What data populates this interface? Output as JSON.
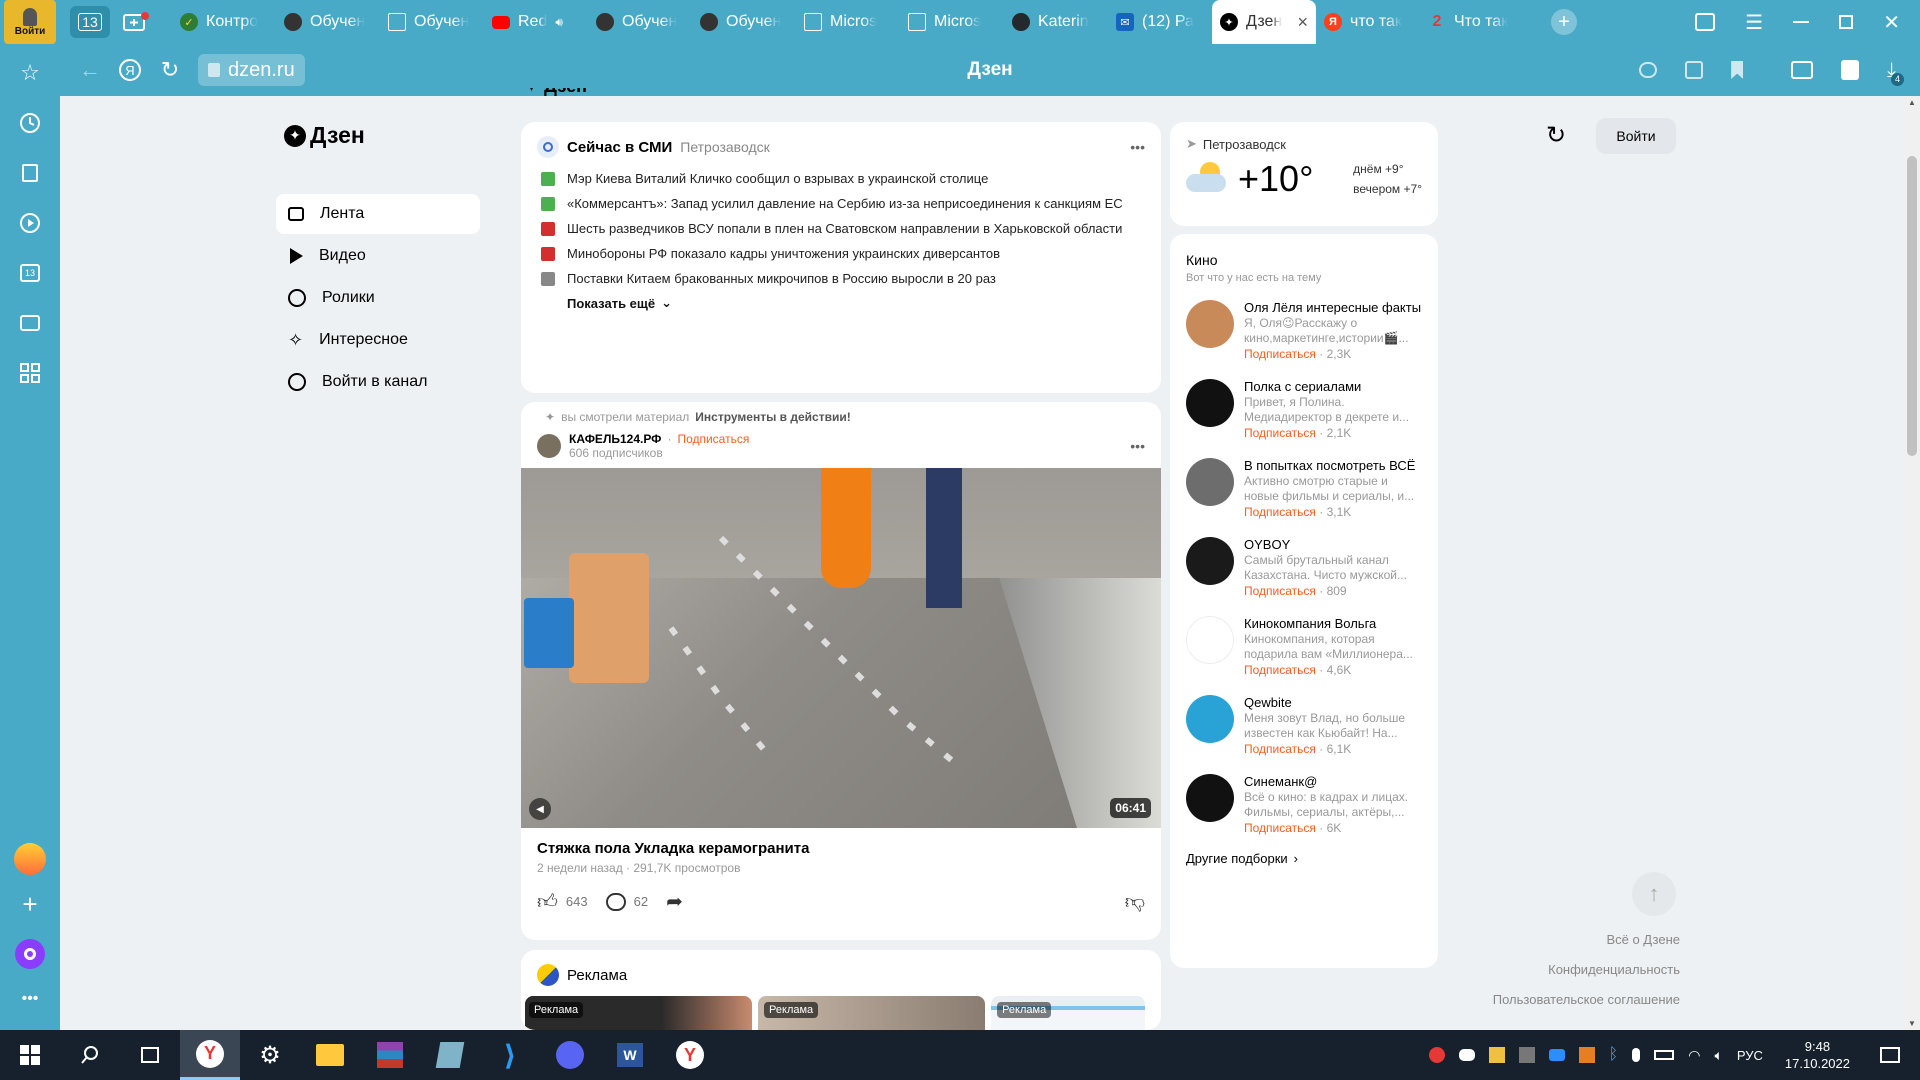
{
  "tabbar": {
    "profile_label": "Войти",
    "tab_count": "13",
    "tabs": [
      {
        "title": "Контро",
        "icon": "check-icon",
        "color": "#2e7d32"
      },
      {
        "title": "Обучен",
        "icon": "openai-icon",
        "color": "#333333"
      },
      {
        "title": "Обучен",
        "icon": "doc-icon",
        "color": "#ffffff"
      },
      {
        "title": "Red",
        "icon": "youtube-icon",
        "color": "#ff0000"
      },
      {
        "title": "Обучен",
        "icon": "openai-icon",
        "color": "#333333"
      },
      {
        "title": "Обучен",
        "icon": "openai-icon",
        "color": "#333333"
      },
      {
        "title": "Micros",
        "icon": "doc-icon",
        "color": "#ffffff"
      },
      {
        "title": "Micros",
        "icon": "doc-icon",
        "color": "#ffffff"
      },
      {
        "title": "Katerin",
        "icon": "github-icon",
        "color": "#24292e"
      },
      {
        "title": "(12) Ра",
        "icon": "mail-icon",
        "color": "#1565c0"
      },
      {
        "title": "Дзен",
        "icon": "dzen-icon",
        "color": "#000000"
      },
      {
        "title": "что так",
        "icon": "yandex-icon",
        "color": "#fc3f1d"
      },
      {
        "title": "Что так",
        "icon": "two-icon",
        "color": "#e53935"
      }
    ]
  },
  "addressbar": {
    "url": "dzen.ru",
    "page_title": "Дзен",
    "downloads_badge": "4"
  },
  "sidebar": {
    "logo": "Дзен",
    "items": [
      {
        "label": "Лента"
      },
      {
        "label": "Видео"
      },
      {
        "label": "Ролики"
      },
      {
        "label": "Интересное"
      },
      {
        "label": "Войти в канал"
      }
    ]
  },
  "header": {
    "login_button": "Войти"
  },
  "news": {
    "title": "Сейчас в СМИ",
    "city": "Петрозаводск",
    "items": [
      {
        "text": "Мэр Киева Виталий Кличко сообщил о взрывах в украинской столице",
        "src": "#4caf50"
      },
      {
        "text": "«Коммерсантъ»: Запад усилил давление на Сербию из-за неприсоединения к санкциям ЕС",
        "src": "#4caf50"
      },
      {
        "text": "Шесть разведчиков ВСУ попали в плен на Сватовском направлении в Харьковской области",
        "src": "#d32f2f"
      },
      {
        "text": "Минобороны РФ показало кадры уничтожения украинских диверсантов",
        "src": "#d32f2f"
      },
      {
        "text": "Поставки Китаем бракованных микрочипов в Россию выросли в 20 раз",
        "src": "#888888"
      }
    ],
    "more": "Показать ещё"
  },
  "post": {
    "hint": "вы смотрели материал",
    "hint_bold": "Инструменты в действии!",
    "channel": "КАФЕЛЬ124.РФ",
    "subscribe": "Подписаться",
    "subscribers": "606 подписчиков",
    "duration": "06:41",
    "title": "Стяжка пола Укладка керамогранита",
    "meta": "2 недели назад · 291,7K просмотров",
    "likes": "643",
    "comments": "62"
  },
  "ads": {
    "title": "Реклама",
    "label": "Реклама"
  },
  "weather": {
    "city": "Петрозаводск",
    "temp": "+10°",
    "day": "днём +9°",
    "evening": "вечером +7°"
  },
  "kino": {
    "title": "Кино",
    "subtitle": "Вот что у нас есть на тему",
    "channels": [
      {
        "name": "Оля Лёля интересные факты",
        "desc": "Я, Оля😉Расскажу о кино,маркетинге,истории🎬...",
        "subs": "2,3K",
        "color": "#c98a5a"
      },
      {
        "name": "Полка с сериалами",
        "desc": "Привет, я Полина. Медиадиректор в декрете и...",
        "subs": "2,1K",
        "color": "#111111"
      },
      {
        "name": "В попытках посмотреть ВСЁ",
        "desc": "Активно смотрю старые и новые фильмы и сериалы, и...",
        "subs": "3,1K",
        "color": "#6d6d6d"
      },
      {
        "name": "OYBOY",
        "desc": "Самый брутальный канал Казахстана. Чисто мужской...",
        "subs": "809",
        "color": "#1a1a1a"
      },
      {
        "name": "Кинокомпания Вольга",
        "desc": "Кинокомпания, которая подарила вам «Миллионера...",
        "subs": "4,6K",
        "color": "#ffffff"
      },
      {
        "name": "Qewbite",
        "desc": "Меня зовут Влад, но больше известен как Кьюбайт! На...",
        "subs": "6,1K",
        "color": "#29a3d6"
      },
      {
        "name": "Синеманк@",
        "desc": "Всё о кино: в кадрах и лицах. Фильмы, сериалы, актёры,...",
        "subs": "6K",
        "color": "#111111"
      }
    ],
    "subscribe": "Подписаться",
    "more": "Другие подборки"
  },
  "footer": {
    "about": "Всё о Дзене",
    "privacy": "Конфиденциальность",
    "terms": "Пользовательское соглашение"
  },
  "taskbar": {
    "lang": "РУС",
    "time": "9:48",
    "date": "17.10.2022"
  },
  "colors": {
    "browser": "#48aac7",
    "accent": "#ff5c1f",
    "taskbar": "#16212d"
  }
}
